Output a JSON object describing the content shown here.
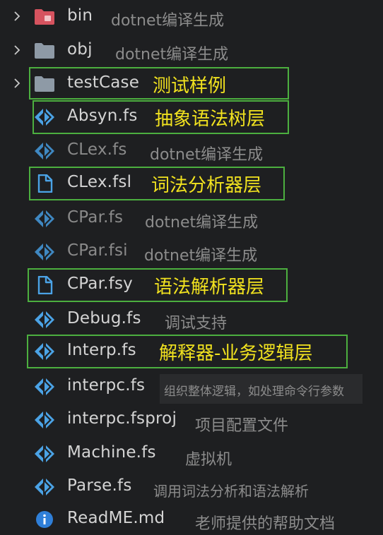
{
  "colors": {
    "background": "#1e1f21",
    "fsharp_icon": "#4ba3e6",
    "highlight_text": "#f1e21f",
    "highlight_border": "#4caf3f",
    "info_icon": "#2f7fd8",
    "bin_folder": "#d6535f",
    "folder": "#8e9aa6"
  },
  "files": [
    {
      "name": "bin",
      "icon": "folder-red-icon",
      "chevron": true,
      "annotation": "dotnet编译生成",
      "highlight": false,
      "dim": false
    },
    {
      "name": "obj",
      "icon": "folder-gray-icon",
      "chevron": true,
      "annotation": "dotnet编译生成",
      "highlight": false,
      "dim": false
    },
    {
      "name": "testCase",
      "icon": "folder-gray-icon",
      "chevron": true,
      "annotation": "测试样例",
      "highlight": true,
      "dim": false
    },
    {
      "name": "Absyn.fs",
      "icon": "fsharp-icon",
      "chevron": false,
      "annotation": "抽象语法树层",
      "highlight": true,
      "dim": false
    },
    {
      "name": "CLex.fs",
      "icon": "fsharp-icon",
      "chevron": false,
      "annotation": "dotnet编译生成",
      "highlight": false,
      "dim": true
    },
    {
      "name": "CLex.fsl",
      "icon": "document-icon",
      "chevron": false,
      "annotation": "词法分析器层",
      "highlight": true,
      "dim": false
    },
    {
      "name": "CPar.fs",
      "icon": "fsharp-icon",
      "chevron": false,
      "annotation": "dotnet编译生成",
      "highlight": false,
      "dim": true
    },
    {
      "name": "CPar.fsi",
      "icon": "fsharp-icon",
      "chevron": false,
      "annotation": "dotnet编译生成",
      "highlight": false,
      "dim": true
    },
    {
      "name": "CPar.fsy",
      "icon": "document-icon",
      "chevron": false,
      "annotation": "语法解析器层",
      "highlight": true,
      "dim": false
    },
    {
      "name": "Debug.fs",
      "icon": "fsharp-icon",
      "chevron": false,
      "annotation": "调试支持",
      "highlight": false,
      "dim": false
    },
    {
      "name": "Interp.fs",
      "icon": "fsharp-icon",
      "chevron": false,
      "annotation": "解释器-业务逻辑层",
      "highlight": true,
      "dim": false
    },
    {
      "name": "interpc.fs",
      "icon": "fsharp-icon",
      "chevron": false,
      "annotation": "组织整体逻辑，如处理命令行参数",
      "highlight": false,
      "dim": false
    },
    {
      "name": "interpc.fsproj",
      "icon": "fsharp-icon",
      "chevron": false,
      "annotation": "项目配置文件",
      "highlight": false,
      "dim": false
    },
    {
      "name": "Machine.fs",
      "icon": "fsharp-icon",
      "chevron": false,
      "annotation": "虚拟机",
      "highlight": false,
      "dim": false
    },
    {
      "name": "Parse.fs",
      "icon": "fsharp-icon",
      "chevron": false,
      "annotation": "调用词法分析和语法解析",
      "highlight": false,
      "dim": false
    },
    {
      "name": "ReadME.md",
      "icon": "info-icon",
      "chevron": false,
      "annotation": "老师提供的帮助文档",
      "highlight": false,
      "dim": false
    }
  ]
}
